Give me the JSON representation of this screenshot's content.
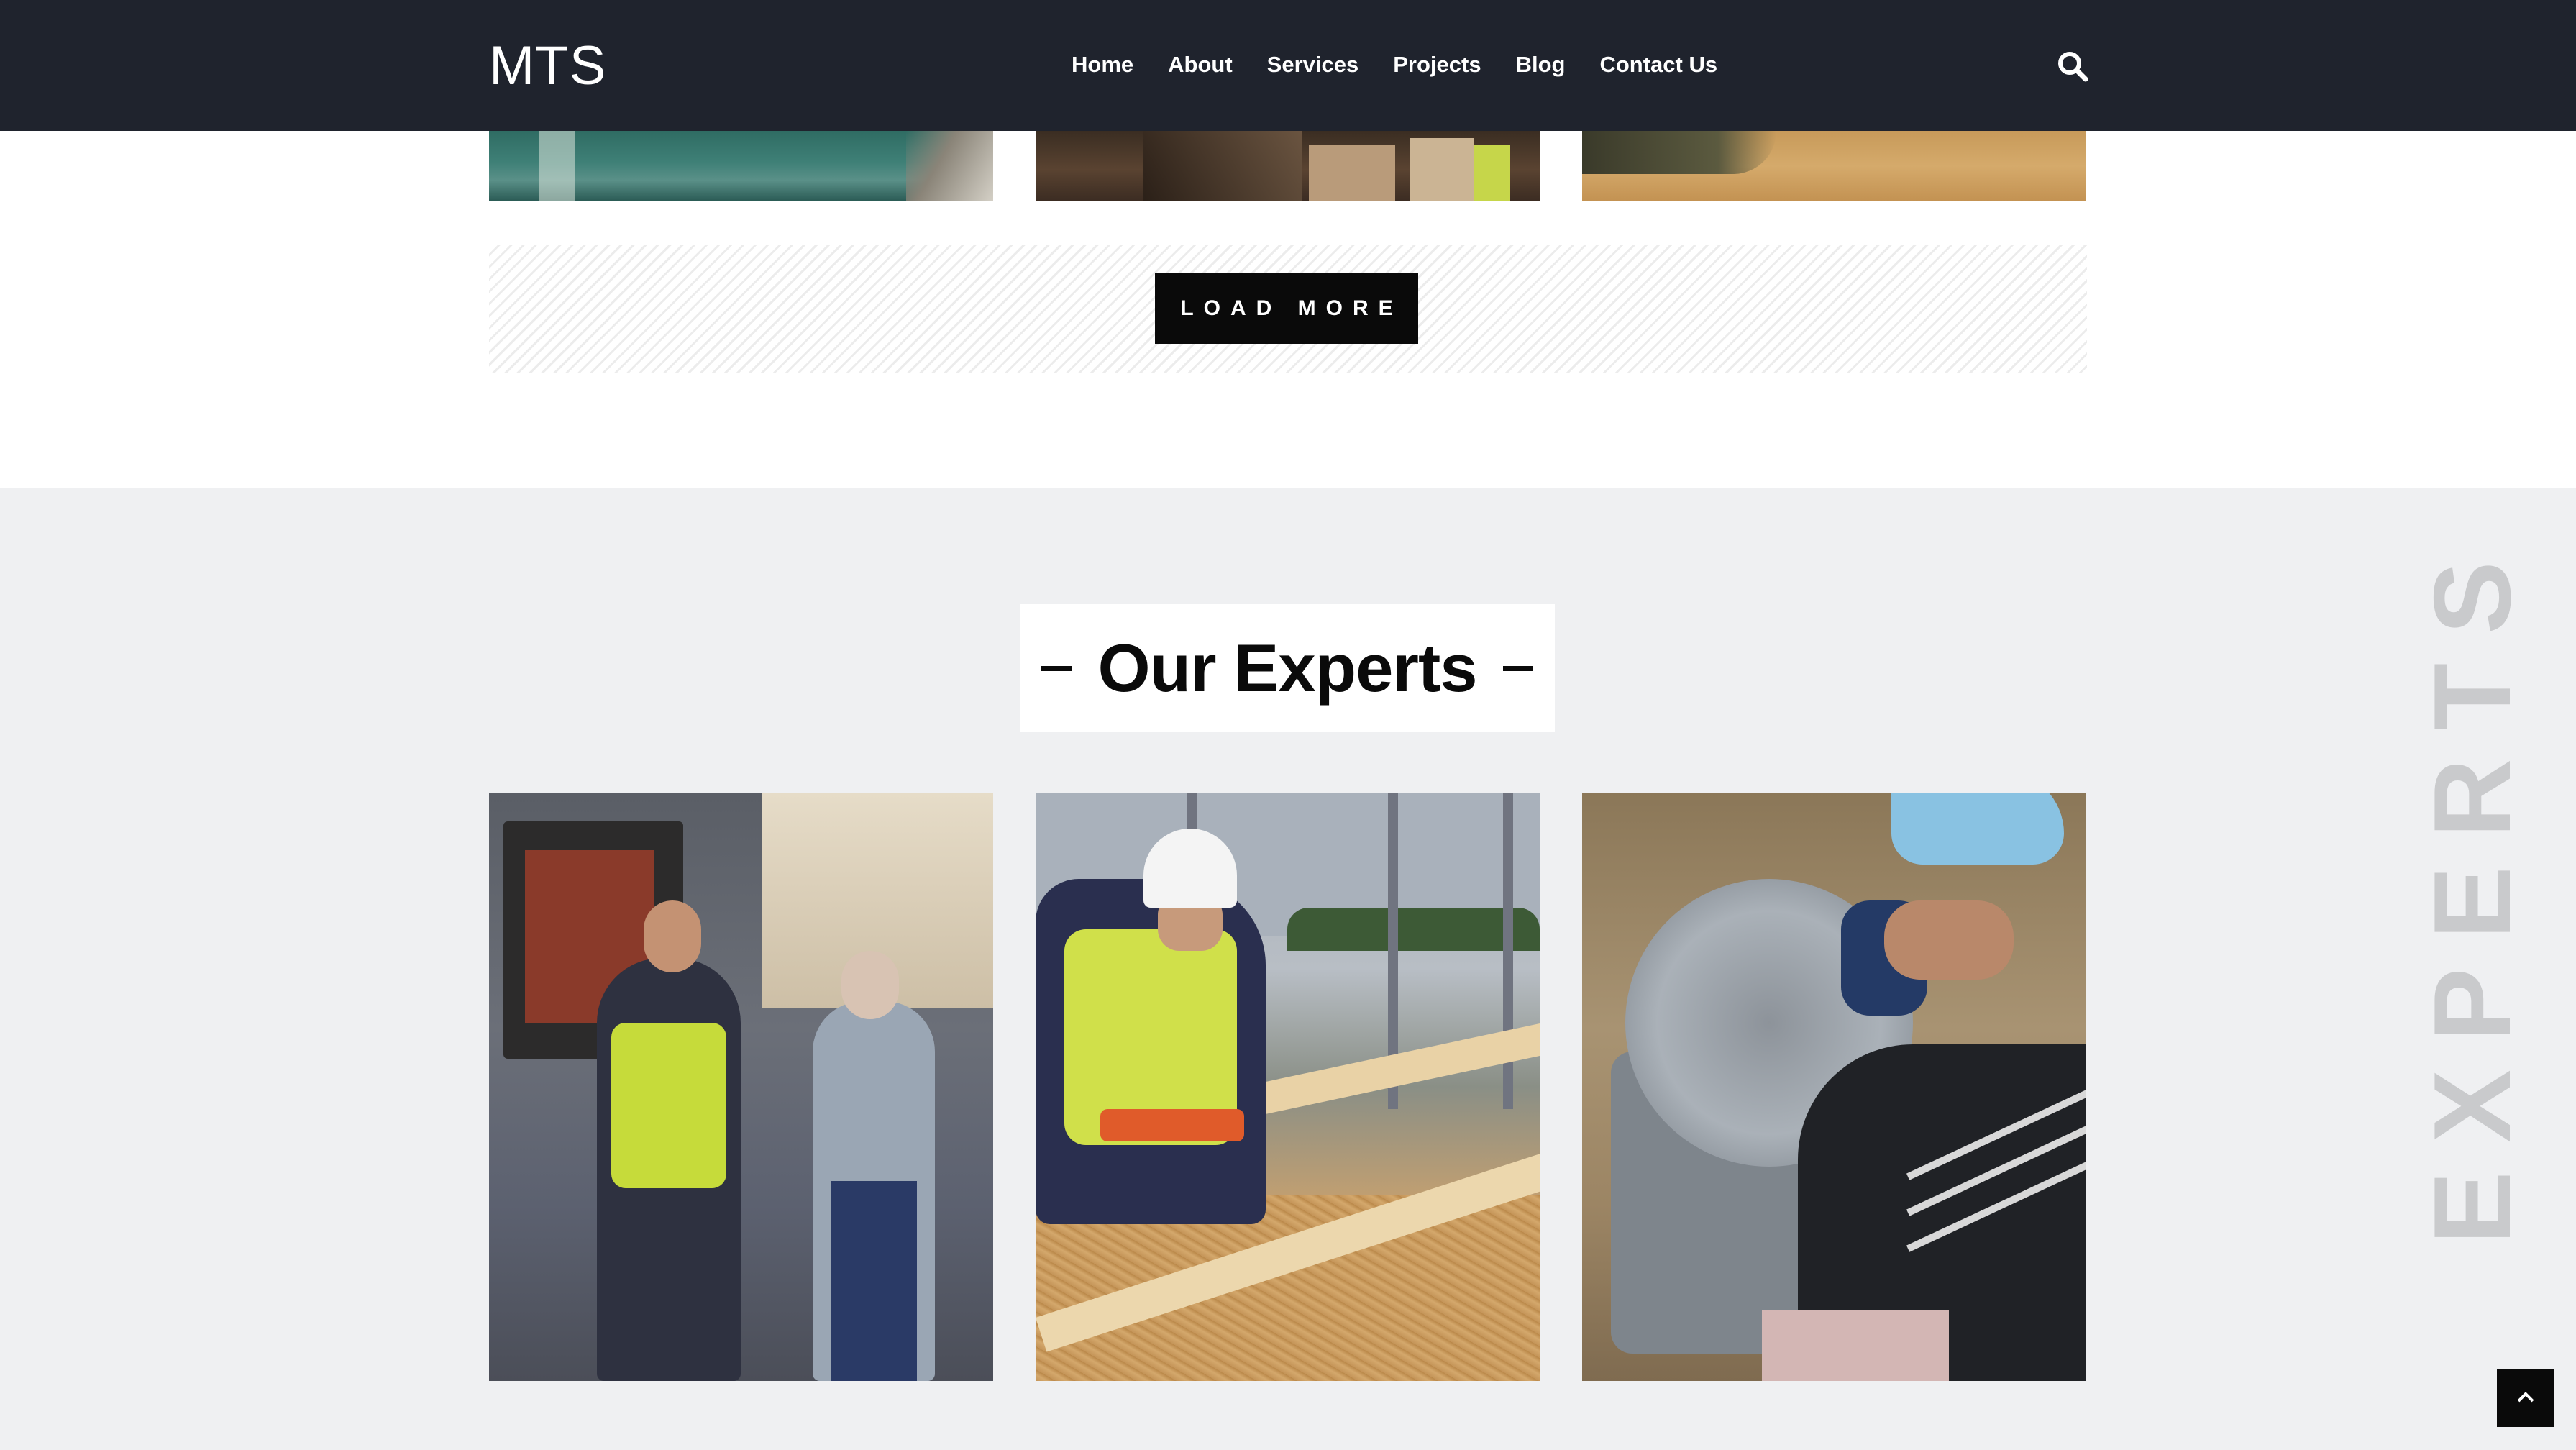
{
  "header": {
    "logo": "MTS",
    "nav": [
      {
        "label": "Home"
      },
      {
        "label": "About"
      },
      {
        "label": "Services"
      },
      {
        "label": "Projects"
      },
      {
        "label": "Blog"
      },
      {
        "label": "Contact Us"
      }
    ],
    "search_icon": "search-icon"
  },
  "projects": {
    "load_more_label": "LOAD MORE"
  },
  "experts": {
    "title": "Our Experts",
    "background_word": "EXPERTS",
    "photos": [
      {
        "name": "expert-photo-warehouse"
      },
      {
        "name": "expert-photo-construction"
      },
      {
        "name": "expert-photo-saw"
      }
    ]
  },
  "back_to_top_icon": "chevron-up-icon",
  "colors": {
    "header_bg": "#1f232d",
    "section_bg": "#eff0f2",
    "button_bg": "#0a0a0a",
    "text_dark": "#0a0a0a",
    "watermark": "#c9cacc"
  }
}
